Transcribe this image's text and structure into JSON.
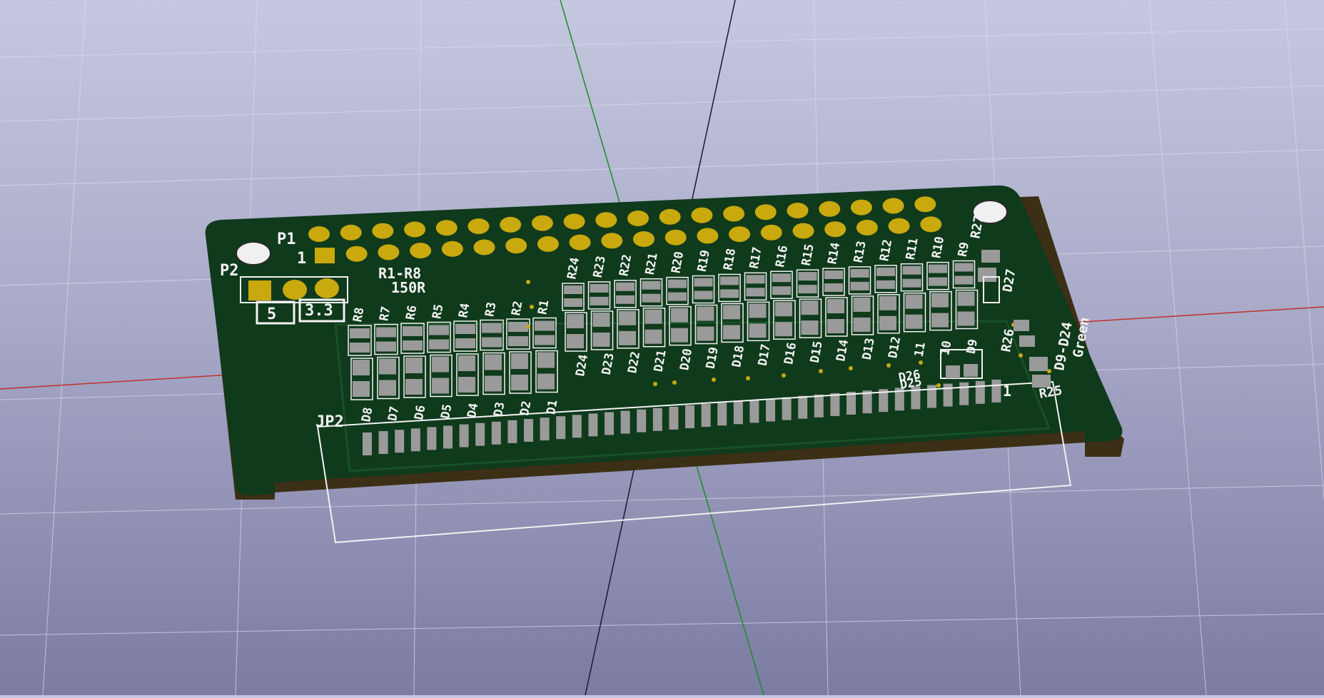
{
  "board": {
    "connector_top_label": "P1",
    "connector_top_pin1": "1",
    "power_header": {
      "ref": "P2",
      "left": "5",
      "right": "3.3"
    },
    "resistor_note": {
      "line1": "R1-R8",
      "line2": "150R"
    },
    "edge_connector": {
      "ref": "JP2",
      "pin1": "1"
    },
    "resistors_left": [
      "R8",
      "R7",
      "R6",
      "R5",
      "R4",
      "R3",
      "R2",
      "R1"
    ],
    "leds_left": [
      "D8",
      "D7",
      "D6",
      "D5",
      "D4",
      "D3",
      "D2",
      "D1"
    ],
    "resistors_right": [
      "R24",
      "R23",
      "R22",
      "R21",
      "R20",
      "R19",
      "R18",
      "R17",
      "R16",
      "R15",
      "R14",
      "R13",
      "R12",
      "R11",
      "R10",
      "R9"
    ],
    "leds_right": [
      "D24",
      "D23",
      "D22",
      "D21",
      "D20",
      "D19",
      "D18",
      "D17",
      "D16",
      "D15",
      "D14",
      "D13",
      "D12",
      "11",
      "10",
      "D9"
    ],
    "extra_labels": {
      "r27": "R27",
      "d27": "D27",
      "r26": "R26",
      "r25": "R25",
      "d26": "D26",
      "d25": "D25",
      "green_note_1": "D9-D24",
      "green_note_2": "Green"
    }
  },
  "colors": {
    "board": "#0f3a1c",
    "board_edge": "#3b2f16",
    "pad_gold": "#c9a90e",
    "smd_pad": "#9a9a9a",
    "silkscreen": "#f2f2f2",
    "axis_x": "#c03030",
    "axis_y": "#1f8a2a",
    "axis_z": "#1a1a2e"
  }
}
